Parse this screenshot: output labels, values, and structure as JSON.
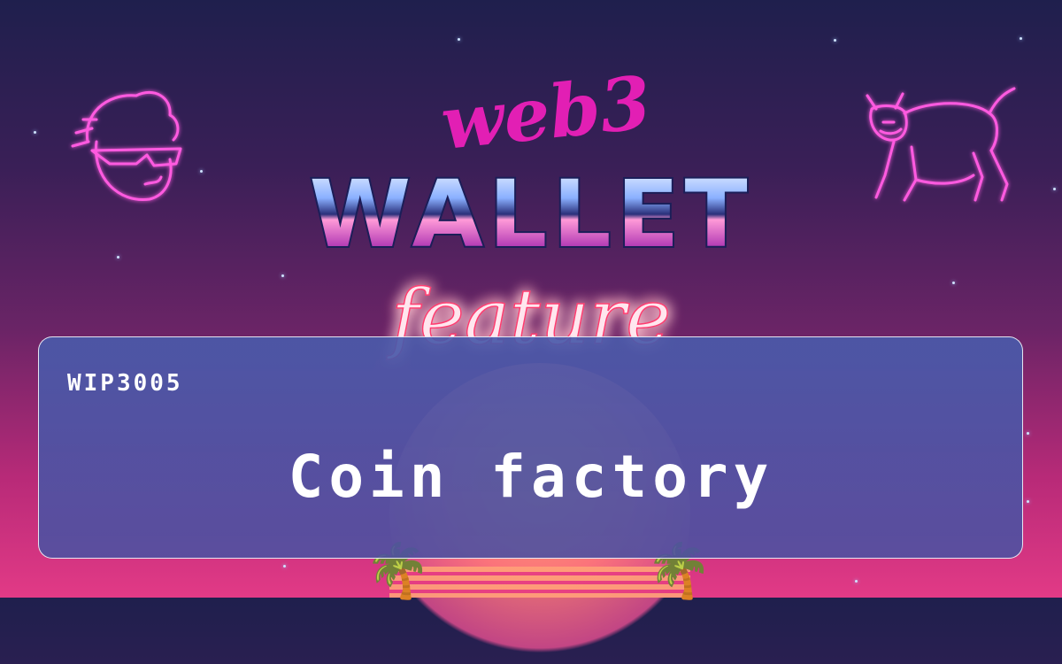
{
  "title": {
    "line1": "web3",
    "line2": "WALLET",
    "line3": "feature"
  },
  "card": {
    "code": "WIP3005",
    "name": "Coin factory"
  },
  "icons": {
    "left": "neon-cool-face-icon",
    "right": "neon-bull-icon",
    "palms": "palm-tree-icon",
    "palm_glyph": "🌴"
  },
  "colors": {
    "web3": "#e21fb4",
    "feature_glow": "#ff3b6f",
    "neon_left": "#ff4fd8",
    "neon_right": "#ff4fd8"
  }
}
